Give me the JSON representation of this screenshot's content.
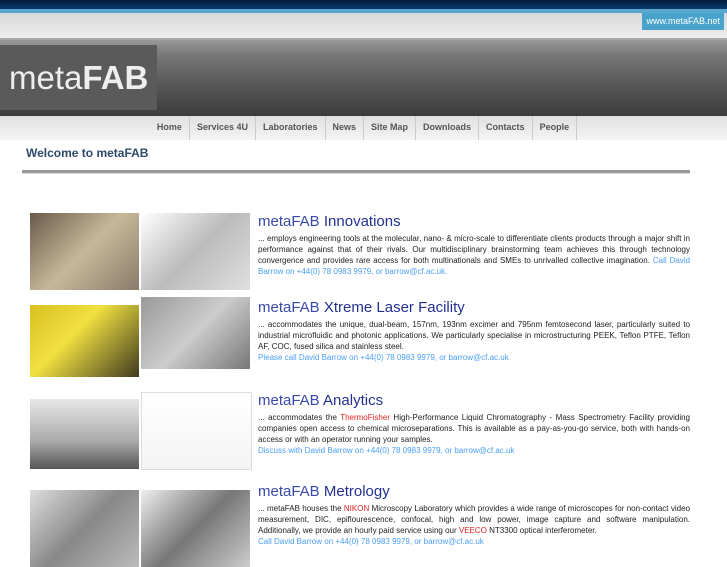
{
  "url_badge": "www.metaFAB.net",
  "logo": {
    "light": "meta",
    "bold": "FAB"
  },
  "nav": [
    "Home",
    "Services 4U",
    "Laboratories",
    "News",
    "Site Map",
    "Downloads",
    "Contacts",
    "People"
  ],
  "welcome": "Welcome to metaFAB",
  "sections": [
    {
      "brand": "metaFAB",
      "title": " Innovations",
      "text": "... employs engineering tools at the molecular, nano- & micro-scale to differentiate clients products through a major shift in performance against that of their rivals. Our multidisciplinary brainstorming team achieves this through technology convergence and provides rare access for both multinationals and SMEs to unrivalled collective imagination. ",
      "contact": "Call David Barrow on +44(0) 78 0983 9979, or barrow@cf.ac.uk."
    },
    {
      "brand": "metaFAB",
      "title": " Xtreme Laser Facility",
      "text": "... accommodates the unique, dual-beam, 157nm, 193nm excimer and 795nm femtosecond laser, particularly suited to industrial microfluidic and photonic applications. We particularly specialise in microstructuring PEEK, Teflon PTFE, Teflon AF, COC, fused silica and stainless steel.",
      "contact": "Please call David Barrow on +44(0) 78 0983 9979, or barrow@cf.ac.uk"
    },
    {
      "brand": "metaFAB",
      "title": " Analytics",
      "t1": "... accommodates the ",
      "red1": "ThermoFisher",
      "t2": " High-Performance Liquid Chromatography - Mass Spectrometry Facility providing companies open access to chemical microseparations. This is available as a pay-as-you-go service, both with hands-on access or with an operator running your samples.",
      "contact": "Discuss with David Barrow on +44(0) 78 0983 9979, or barrow@cf.ac.uk"
    },
    {
      "brand": "metaFAB",
      "title": " Metrology",
      "t1": "... metaFAB houses the ",
      "red1": "NIKON",
      "t2": " Microscopy Laboratory which provides a wide range of microscopes for non-contact video measurement, DIC, epiflourescence, confocal, high and low power, image capture and software manipulation. Additionally, we provide an hourly paid service using our ",
      "red2": "VEECO",
      "t3": " NT3300 optical interferometer.",
      "contact": "Call David Barrow on +44(0) 78 0983 9979, or barrow@cf.ac.uk"
    }
  ]
}
